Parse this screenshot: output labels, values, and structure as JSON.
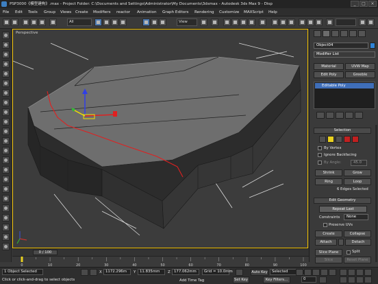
{
  "window": {
    "title": "PSP3000《模型建构》.max  - Project Folder: C:\\Documents and Settings\\Administrator\\My Documents\\3dsmax  - Autodesk 3ds Max 9  - Disp"
  },
  "menu": [
    "File",
    "Edit",
    "Tools",
    "Group",
    "Views",
    "Create",
    "Modifiers",
    "reactor",
    "Animation",
    "Graph Editors",
    "Rendering",
    "Customize",
    "MAXScript",
    "Help"
  ],
  "toolbar": {
    "selection_filter": "All",
    "ref_coord": "View"
  },
  "viewport": {
    "label": "Perspective"
  },
  "command_panel": {
    "object_name": "Object04",
    "object_color": "#2f83d6",
    "modifier_list": "Modifier List",
    "buttons": {
      "material": "Material",
      "uvw_map": "UVW Map",
      "edit_poly": "Edit Poly",
      "greeble": "Greeble"
    },
    "stack_item": "Editable Poly",
    "selection": {
      "title": "Selection",
      "by_vertex": "By Vertex",
      "ignore_backfacing": "Ignore Backfacing",
      "by_angle": "By Angle:",
      "angle_value": "45.0",
      "shrink": "Shrink",
      "grow": "Grow",
      "ring": "Ring",
      "loop": "Loop",
      "status": "6 Edges Selected"
    },
    "edit_geometry": {
      "title": "Edit Geometry",
      "repeat_last": "Repeat Last",
      "constraints": "Constraints",
      "constraints_value": "None",
      "preserve_uvs": "Preserve UVs",
      "create": "Create",
      "collapse": "Collapse",
      "attach": "Attach",
      "detach": "Detach",
      "slice_plane": "Slice Plane",
      "split": "Split",
      "slice": "Slice",
      "reset_plane": "Reset Plane"
    }
  },
  "timeline": {
    "frame_label": "0 / 100",
    "ticks": [
      "0",
      "10",
      "20",
      "30",
      "40",
      "50",
      "60",
      "70",
      "80",
      "90",
      "100"
    ]
  },
  "status": {
    "selected_count": "1 Object Selected",
    "prompt": "Click or click-and-drag to select objects",
    "x_label": "X",
    "x": "1172.296m",
    "y_label": "Y",
    "y": "11.835mm",
    "z_label": "Z",
    "z": "177.062mm",
    "grid": "Grid = 10.0mm",
    "add_time_tag": "Add Time Tag",
    "auto_key": "Auto Key",
    "set_key": "Set Key",
    "key_mode": "Selected",
    "key_filters": "Key Filters...",
    "frame_number": "0"
  },
  "colors": {
    "viewport_active_border": "#f2c100",
    "selected_edge": "#e02020",
    "stack_highlight": "#3f6eb8"
  }
}
